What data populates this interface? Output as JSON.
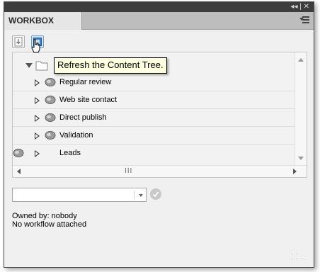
{
  "window": {
    "controls": "◂◂ | ✕"
  },
  "tab": {
    "label": "WORKBOX"
  },
  "toolbar": {
    "buttons": [
      {
        "icon": "download-icon"
      },
      {
        "icon": "refresh-icon"
      }
    ]
  },
  "tooltip": {
    "text": "Refresh the Content Tree."
  },
  "tree": {
    "root": {
      "label": ""
    },
    "items": [
      {
        "label": "Regular review"
      },
      {
        "label": "Web site contact"
      },
      {
        "label": "Direct publish"
      },
      {
        "label": "Validation"
      },
      {
        "label": "Leads"
      }
    ]
  },
  "hscroll": {
    "grip": "III"
  },
  "actions": {
    "combo_value": "",
    "confirm_icon": "checkmark-icon"
  },
  "info": {
    "owned_by": "Owned by: nobody",
    "workflow": "No workflow attached"
  },
  "colors": {
    "titlebar": "#3d3d3d",
    "tooltip_bg": "#ffffe1",
    "selected_button": "#d7e6f6"
  }
}
